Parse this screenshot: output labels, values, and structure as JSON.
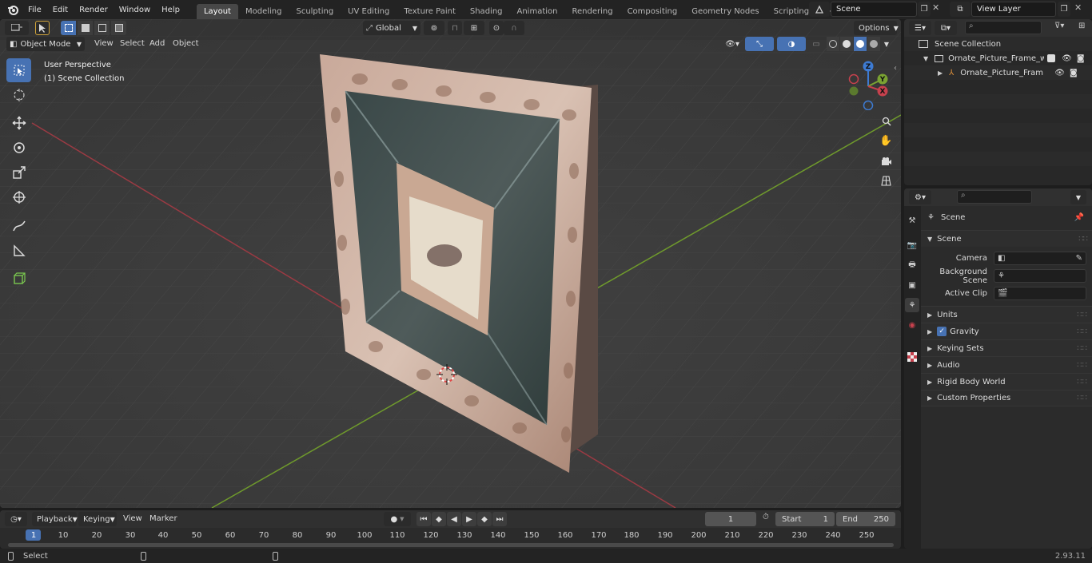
{
  "menu": {
    "file": "File",
    "edit": "Edit",
    "render": "Render",
    "window": "Window",
    "help": "Help"
  },
  "workspaces": [
    "Layout",
    "Modeling",
    "Sculpting",
    "UV Editing",
    "Texture Paint",
    "Shading",
    "Animation",
    "Rendering",
    "Compositing",
    "Geometry Nodes",
    "Scripting"
  ],
  "scene_name": "Scene",
  "view_layer": "View Layer",
  "viewport": {
    "mode": "Object Mode",
    "menu": [
      "View",
      "Select",
      "Add",
      "Object"
    ],
    "orientation": "Global",
    "options": "Options",
    "info_title": "User Perspective",
    "info_collection": "(1) Scene Collection"
  },
  "outliner": {
    "root": "Scene Collection",
    "items": [
      "Ornate_Picture_Frame_with_I",
      "Ornate_Picture_Frame_w"
    ]
  },
  "properties": {
    "context": "Scene",
    "section": "Scene",
    "camera_label": "Camera",
    "bg_scene_label": "Background Scene",
    "active_clip_label": "Active Clip",
    "panels": [
      "Units",
      "Gravity",
      "Keying Sets",
      "Audio",
      "Rigid Body World",
      "Custom Properties"
    ]
  },
  "timeline": {
    "menu": [
      "Playback",
      "Keying",
      "View",
      "Marker"
    ],
    "current_frame": "1",
    "start_label": "Start",
    "start_value": "1",
    "end_label": "End",
    "end_value": "250",
    "ticks": [
      "1",
      "10",
      "20",
      "30",
      "40",
      "50",
      "60",
      "70",
      "80",
      "90",
      "100",
      "110",
      "120",
      "130",
      "140",
      "150",
      "160",
      "170",
      "180",
      "190",
      "200",
      "210",
      "220",
      "230",
      "240",
      "250"
    ]
  },
  "statusbar": {
    "select": "Select",
    "version": "2.93.11"
  },
  "colors": {
    "accent": "#4772b3",
    "x_axis": "#c7414d",
    "y_axis": "#7aa332",
    "z_axis": "#3d7bd3"
  }
}
